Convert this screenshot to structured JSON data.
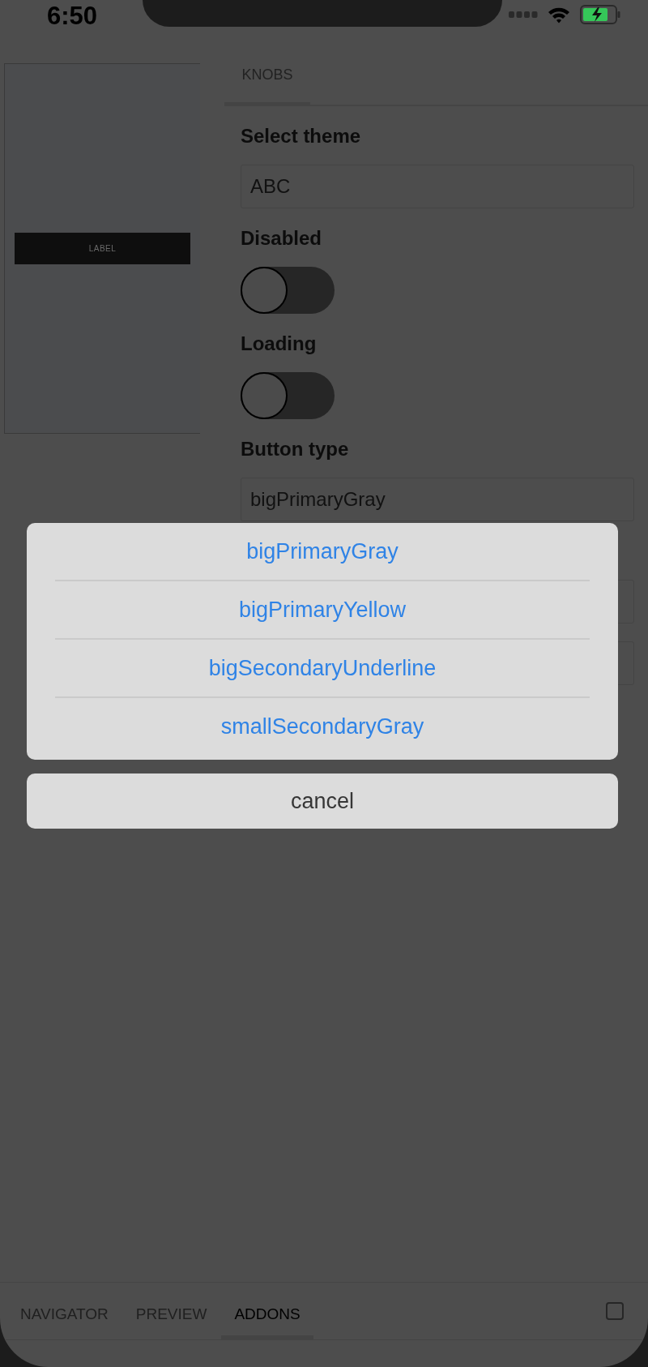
{
  "status_bar": {
    "time": "6:50"
  },
  "preview": {
    "button_label": "LABEL"
  },
  "addon_tabs": [
    {
      "label": "KNOBS",
      "selected": true
    }
  ],
  "knobs": [
    {
      "kind": "text",
      "label": "Select theme",
      "value": "ABC"
    },
    {
      "kind": "toggle",
      "label": "Disabled",
      "on": false
    },
    {
      "kind": "toggle",
      "label": "Loading",
      "on": false
    },
    {
      "kind": "text",
      "label": "Button type",
      "value": "bigPrimaryGray"
    },
    {
      "kind": "text"
    },
    {
      "kind": "text"
    }
  ],
  "action_sheet": {
    "options": [
      "bigPrimaryGray",
      "bigPrimaryYellow",
      "bigSecondaryUnderline",
      "smallSecondaryGray"
    ],
    "cancel": "cancel"
  },
  "bottom_tabs": [
    {
      "label": "NAVIGATOR",
      "selected": false
    },
    {
      "label": "PREVIEW",
      "selected": false
    },
    {
      "label": "ADDONS",
      "selected": true
    }
  ]
}
